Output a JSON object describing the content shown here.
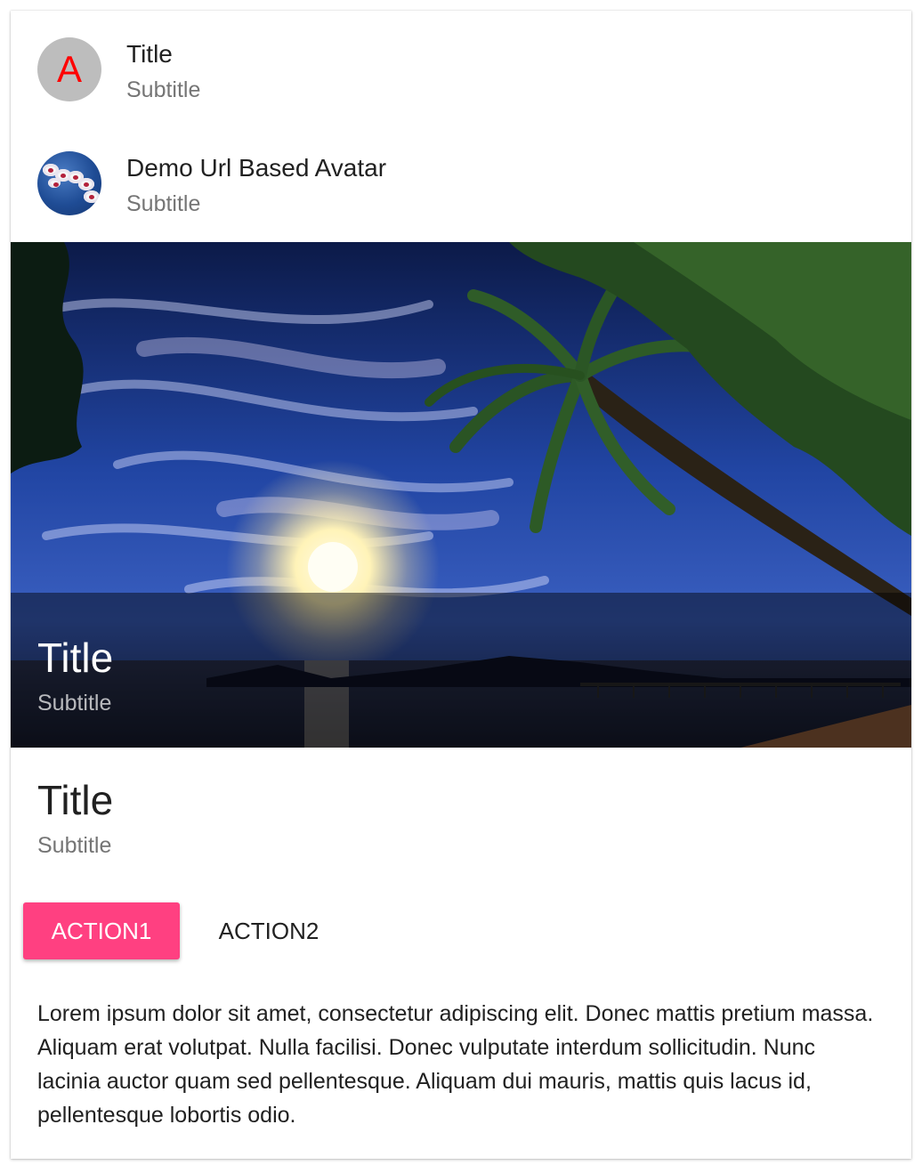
{
  "header_1": {
    "avatar_letter": "A",
    "title": "Title",
    "subtitle": "Subtitle"
  },
  "header_2": {
    "avatar_icon": "orchid-avatar-image",
    "title": "Demo Url Based Avatar",
    "subtitle": "Subtitle"
  },
  "media": {
    "image": "tropical-beach-sunset-photo",
    "overlay_title": "Title",
    "overlay_subtitle": "Subtitle"
  },
  "card_title": {
    "title": "Title",
    "subtitle": "Subtitle"
  },
  "actions": {
    "action1_label": "ACTION1",
    "action2_label": "ACTION2"
  },
  "card_text": "Lorem ipsum dolor sit amet, consectetur adipiscing elit. Donec mattis pretium massa. Aliquam erat volutpat. Nulla facilisi. Donec vulputate interdum sollicitudin. Nunc lacinia auctor quam sed pellentesque. Aliquam dui mauris, mattis quis lacus id, pellentesque lobortis odio.",
  "colors": {
    "accent": "#ff4081",
    "avatar_background": "#bdbdbd",
    "avatar_letter": "#ff0000",
    "primary_text": "#212121",
    "secondary_text": "#757575"
  }
}
